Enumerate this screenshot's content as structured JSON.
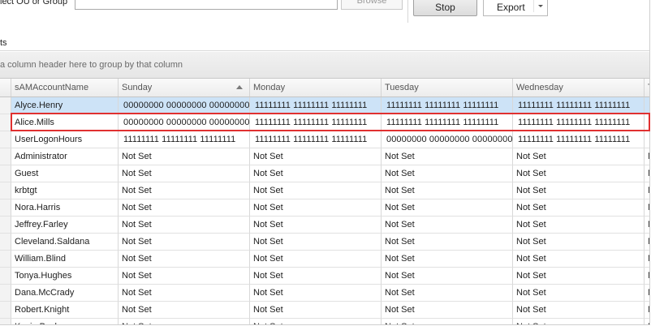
{
  "toolbar": {
    "ou_label": "lect OU or Group",
    "ou_value": "",
    "browse_label": "Browse",
    "stop_label": "Stop",
    "export_label": "Export"
  },
  "results_label": "ts",
  "group_panel_text": "a column header here to group by that column",
  "grid": {
    "columns": [
      "sAMAccountName",
      "Sunday",
      "Monday",
      "Tuesday",
      "Wednesday",
      "T"
    ],
    "sorted_column": "Sunday",
    "sort_direction": "ascending",
    "rows": [
      {
        "name": "Alyce.Henry",
        "sunday": "00000000 00000000 00000000",
        "monday": "11111111 11111111 11111111",
        "tuesday": "11111111 11111111 11111111",
        "wednesday": "11111111 11111111 11111111",
        "thursday": "1",
        "selected": true
      },
      {
        "name": "Alice.Mills",
        "sunday": "00000000 00000000 00000000",
        "monday": "11111111 11111111 11111111",
        "tuesday": "11111111 11111111 11111111",
        "wednesday": "11111111 11111111 11111111",
        "thursday": "1",
        "highlighted": true
      },
      {
        "name": "UserLogonHours",
        "sunday": "11111111 11111111 11111111",
        "monday": "11111111 11111111 11111111",
        "tuesday": "00000000 00000000 00000000",
        "wednesday": "11111111 11111111 11111111",
        "thursday": "1"
      },
      {
        "name": "Administrator",
        "sunday": "Not Set",
        "monday": "Not Set",
        "tuesday": "Not Set",
        "wednesday": "Not Set",
        "thursday": "N"
      },
      {
        "name": "Guest",
        "sunday": "Not Set",
        "monday": "Not Set",
        "tuesday": "Not Set",
        "wednesday": "Not Set",
        "thursday": "N"
      },
      {
        "name": "krbtgt",
        "sunday": "Not Set",
        "monday": "Not Set",
        "tuesday": "Not Set",
        "wednesday": "Not Set",
        "thursday": "N"
      },
      {
        "name": "Nora.Harris",
        "sunday": "Not Set",
        "monday": "Not Set",
        "tuesday": "Not Set",
        "wednesday": "Not Set",
        "thursday": "N"
      },
      {
        "name": "Jeffrey.Farley",
        "sunday": "Not Set",
        "monday": "Not Set",
        "tuesday": "Not Set",
        "wednesday": "Not Set",
        "thursday": "N"
      },
      {
        "name": "Cleveland.Saldana",
        "sunday": "Not Set",
        "monday": "Not Set",
        "tuesday": "Not Set",
        "wednesday": "Not Set",
        "thursday": "N"
      },
      {
        "name": "William.Blind",
        "sunday": "Not Set",
        "monday": "Not Set",
        "tuesday": "Not Set",
        "wednesday": "Not Set",
        "thursday": "N"
      },
      {
        "name": "Tonya.Hughes",
        "sunday": "Not Set",
        "monday": "Not Set",
        "tuesday": "Not Set",
        "wednesday": "Not Set",
        "thursday": "N"
      },
      {
        "name": "Dana.McCrady",
        "sunday": "Not Set",
        "monday": "Not Set",
        "tuesday": "Not Set",
        "wednesday": "Not Set",
        "thursday": "N"
      },
      {
        "name": "Robert.Knight",
        "sunday": "Not Set",
        "monday": "Not Set",
        "tuesday": "Not Set",
        "wednesday": "Not Set",
        "thursday": "N"
      },
      {
        "name": "Kevin.Becker",
        "sunday": "Not Set",
        "monday": "Not Set",
        "tuesday": "Not Set",
        "wednesday": "Not Set",
        "thursday": "N"
      }
    ]
  },
  "colors": {
    "selected_row": "#cde3f7",
    "highlight_border": "#e03030"
  }
}
